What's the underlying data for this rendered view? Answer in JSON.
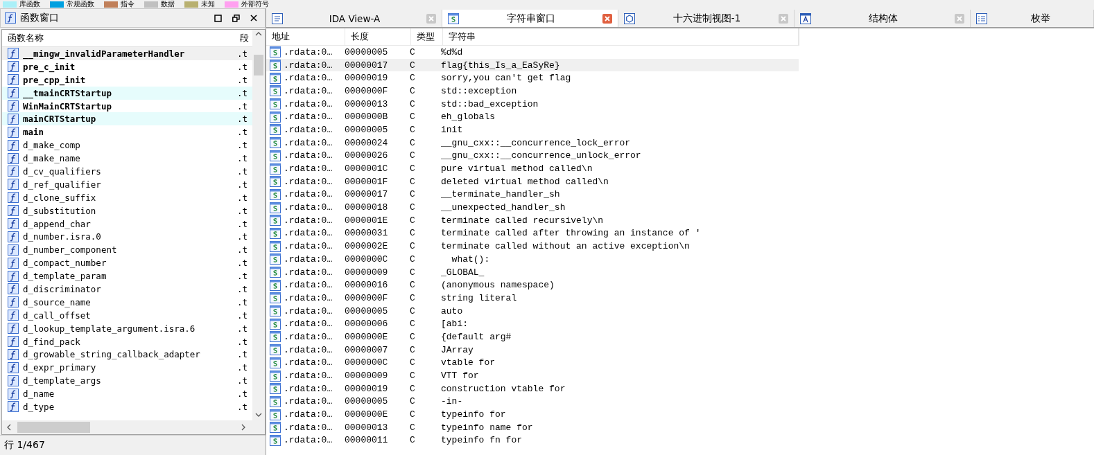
{
  "legend": [
    {
      "label": "库函数",
      "color": "#aaf0f8"
    },
    {
      "label": "常规函数",
      "color": "#00a0e0"
    },
    {
      "label": "指令",
      "color": "#c0805a"
    },
    {
      "label": "数据",
      "color": "#c0c0c0"
    },
    {
      "label": "未知",
      "color": "#b8b070"
    },
    {
      "label": "外部符号",
      "color": "#ffa0f0"
    }
  ],
  "functions_window": {
    "title": "函数窗口",
    "columns": [
      "函数名称",
      "段"
    ],
    "rows": [
      {
        "name": "__mingw_invalidParameterHandler",
        "segment": ".t",
        "bold": true,
        "selected": true,
        "library": false
      },
      {
        "name": "pre_c_init",
        "segment": ".t",
        "bold": true,
        "selected": false,
        "library": false
      },
      {
        "name": "pre_cpp_init",
        "segment": ".t",
        "bold": true,
        "selected": false,
        "library": false
      },
      {
        "name": "__tmainCRTStartup",
        "segment": ".t",
        "bold": true,
        "selected": false,
        "library": true
      },
      {
        "name": "WinMainCRTStartup",
        "segment": ".t",
        "bold": true,
        "selected": false,
        "library": false
      },
      {
        "name": "mainCRTStartup",
        "segment": ".t",
        "bold": true,
        "selected": false,
        "library": true
      },
      {
        "name": "main",
        "segment": ".t",
        "bold": true,
        "selected": false,
        "library": false
      },
      {
        "name": "d_make_comp",
        "segment": ".t",
        "bold": false,
        "selected": false,
        "library": false
      },
      {
        "name": "d_make_name",
        "segment": ".t",
        "bold": false,
        "selected": false,
        "library": false
      },
      {
        "name": "d_cv_qualifiers",
        "segment": ".t",
        "bold": false,
        "selected": false,
        "library": false
      },
      {
        "name": "d_ref_qualifier",
        "segment": ".t",
        "bold": false,
        "selected": false,
        "library": false
      },
      {
        "name": "d_clone_suffix",
        "segment": ".t",
        "bold": false,
        "selected": false,
        "library": false
      },
      {
        "name": "d_substitution",
        "segment": ".t",
        "bold": false,
        "selected": false,
        "library": false
      },
      {
        "name": "d_append_char",
        "segment": ".t",
        "bold": false,
        "selected": false,
        "library": false
      },
      {
        "name": "d_number.isra.0",
        "segment": ".t",
        "bold": false,
        "selected": false,
        "library": false
      },
      {
        "name": "d_number_component",
        "segment": ".t",
        "bold": false,
        "selected": false,
        "library": false
      },
      {
        "name": "d_compact_number",
        "segment": ".t",
        "bold": false,
        "selected": false,
        "library": false
      },
      {
        "name": "d_template_param",
        "segment": ".t",
        "bold": false,
        "selected": false,
        "library": false
      },
      {
        "name": "d_discriminator",
        "segment": ".t",
        "bold": false,
        "selected": false,
        "library": false
      },
      {
        "name": "d_source_name",
        "segment": ".t",
        "bold": false,
        "selected": false,
        "library": false
      },
      {
        "name": "d_call_offset",
        "segment": ".t",
        "bold": false,
        "selected": false,
        "library": false
      },
      {
        "name": "d_lookup_template_argument.isra.6",
        "segment": ".t",
        "bold": false,
        "selected": false,
        "library": false
      },
      {
        "name": "d_find_pack",
        "segment": ".t",
        "bold": false,
        "selected": false,
        "library": false
      },
      {
        "name": "d_growable_string_callback_adapter",
        "segment": ".t",
        "bold": false,
        "selected": false,
        "library": false
      },
      {
        "name": "d_expr_primary",
        "segment": ".t",
        "bold": false,
        "selected": false,
        "library": false
      },
      {
        "name": "d_template_args",
        "segment": ".t",
        "bold": false,
        "selected": false,
        "library": false
      },
      {
        "name": "d_name",
        "segment": ".t",
        "bold": false,
        "selected": false,
        "library": false
      },
      {
        "name": "d_type",
        "segment": ".t",
        "bold": false,
        "selected": false,
        "library": false
      }
    ],
    "status": "行 1/467"
  },
  "tabs": [
    {
      "label": "IDA View-A",
      "selected": false,
      "closable": true
    },
    {
      "label": "字符串窗口",
      "selected": true,
      "closable": true
    },
    {
      "label": "十六进制视图-1",
      "selected": false,
      "closable": true
    },
    {
      "label": "结构体",
      "selected": false,
      "closable": true
    },
    {
      "label": "枚举",
      "selected": false,
      "closable": false
    }
  ],
  "strings_table": {
    "columns": [
      "地址",
      "长度",
      "类型",
      "字符串"
    ],
    "rows": [
      {
        "address": ".rdata:0…",
        "length": "00000005",
        "type": "C",
        "string": "%d%d",
        "selected": false
      },
      {
        "address": ".rdata:0…",
        "length": "00000017",
        "type": "C",
        "string": "flag{this_Is_a_EaSyRe}",
        "selected": true
      },
      {
        "address": ".rdata:0…",
        "length": "00000019",
        "type": "C",
        "string": "sorry,you can't get flag",
        "selected": false
      },
      {
        "address": ".rdata:0…",
        "length": "0000000F",
        "type": "C",
        "string": "std::exception",
        "selected": false
      },
      {
        "address": ".rdata:0…",
        "length": "00000013",
        "type": "C",
        "string": "std::bad_exception",
        "selected": false
      },
      {
        "address": ".rdata:0…",
        "length": "0000000B",
        "type": "C",
        "string": "eh_globals",
        "selected": false
      },
      {
        "address": ".rdata:0…",
        "length": "00000005",
        "type": "C",
        "string": "init",
        "selected": false
      },
      {
        "address": ".rdata:0…",
        "length": "00000024",
        "type": "C",
        "string": "__gnu_cxx::__concurrence_lock_error",
        "selected": false
      },
      {
        "address": ".rdata:0…",
        "length": "00000026",
        "type": "C",
        "string": "__gnu_cxx::__concurrence_unlock_error",
        "selected": false
      },
      {
        "address": ".rdata:0…",
        "length": "0000001C",
        "type": "C",
        "string": "pure virtual method called\\n",
        "selected": false
      },
      {
        "address": ".rdata:0…",
        "length": "0000001F",
        "type": "C",
        "string": "deleted virtual method called\\n",
        "selected": false
      },
      {
        "address": ".rdata:0…",
        "length": "00000017",
        "type": "C",
        "string": "__terminate_handler_sh",
        "selected": false
      },
      {
        "address": ".rdata:0…",
        "length": "00000018",
        "type": "C",
        "string": "__unexpected_handler_sh",
        "selected": false
      },
      {
        "address": ".rdata:0…",
        "length": "0000001E",
        "type": "C",
        "string": "terminate called recursively\\n",
        "selected": false
      },
      {
        "address": ".rdata:0…",
        "length": "00000031",
        "type": "C",
        "string": "terminate called after throwing an instance of '",
        "selected": false
      },
      {
        "address": ".rdata:0…",
        "length": "0000002E",
        "type": "C",
        "string": "terminate called without an active exception\\n",
        "selected": false
      },
      {
        "address": ".rdata:0…",
        "length": "0000000C",
        "type": "C",
        "string": "  what():",
        "selected": false
      },
      {
        "address": ".rdata:0…",
        "length": "00000009",
        "type": "C",
        "string": "_GLOBAL_",
        "selected": false
      },
      {
        "address": ".rdata:0…",
        "length": "00000016",
        "type": "C",
        "string": "(anonymous namespace)",
        "selected": false
      },
      {
        "address": ".rdata:0…",
        "length": "0000000F",
        "type": "C",
        "string": "string literal",
        "selected": false
      },
      {
        "address": ".rdata:0…",
        "length": "00000005",
        "type": "C",
        "string": "auto",
        "selected": false
      },
      {
        "address": ".rdata:0…",
        "length": "00000006",
        "type": "C",
        "string": "[abi:",
        "selected": false
      },
      {
        "address": ".rdata:0…",
        "length": "0000000E",
        "type": "C",
        "string": "{default arg#",
        "selected": false
      },
      {
        "address": ".rdata:0…",
        "length": "00000007",
        "type": "C",
        "string": "JArray",
        "selected": false
      },
      {
        "address": ".rdata:0…",
        "length": "0000000C",
        "type": "C",
        "string": "vtable for",
        "selected": false
      },
      {
        "address": ".rdata:0…",
        "length": "00000009",
        "type": "C",
        "string": "VTT for",
        "selected": false
      },
      {
        "address": ".rdata:0…",
        "length": "00000019",
        "type": "C",
        "string": "construction vtable for",
        "selected": false
      },
      {
        "address": ".rdata:0…",
        "length": "00000005",
        "type": "C",
        "string": "-in-",
        "selected": false
      },
      {
        "address": ".rdata:0…",
        "length": "0000000E",
        "type": "C",
        "string": "typeinfo for",
        "selected": false
      },
      {
        "address": ".rdata:0…",
        "length": "00000013",
        "type": "C",
        "string": "typeinfo name for",
        "selected": false
      },
      {
        "address": ".rdata:0…",
        "length": "00000011",
        "type": "C",
        "string": "typeinfo fn for",
        "selected": false
      }
    ]
  }
}
